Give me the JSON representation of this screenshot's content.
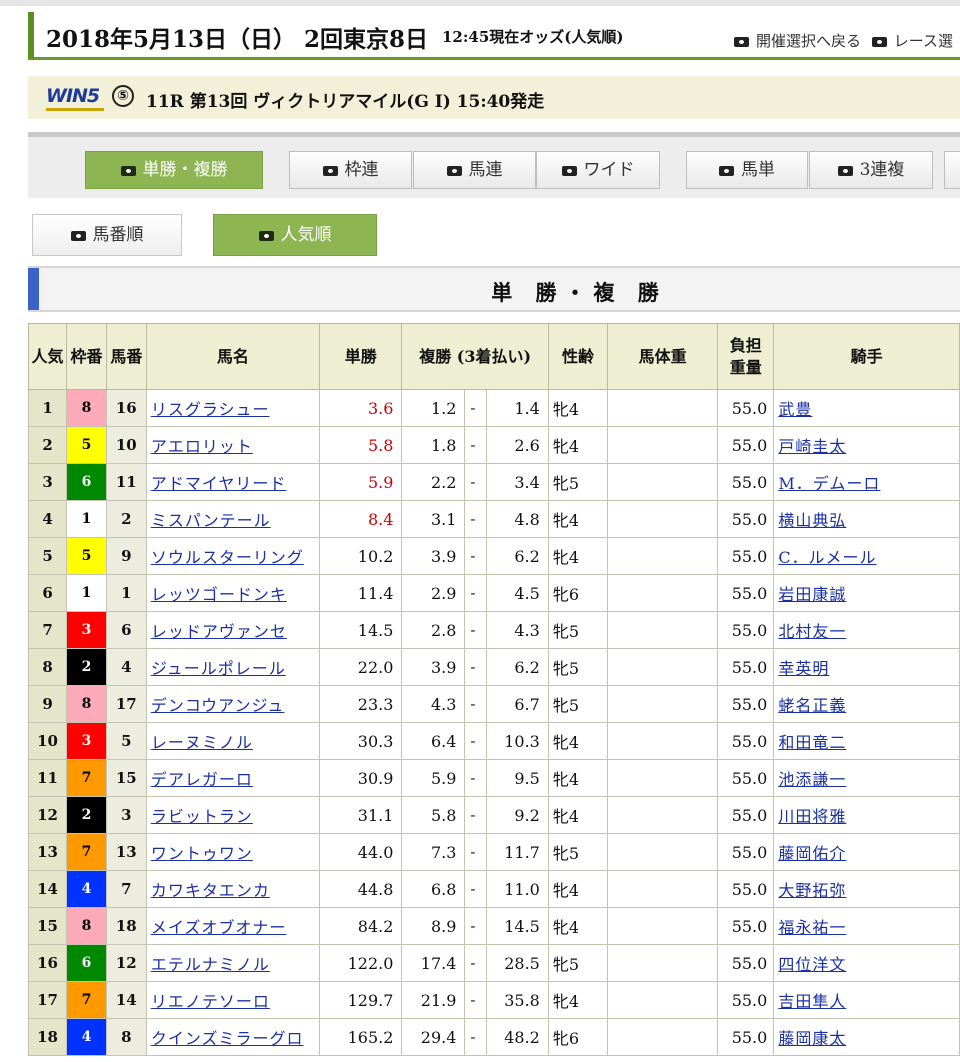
{
  "header": {
    "date_race": "2018年5月13日（日） 2回東京8日",
    "odds_time": "12:45現在オッズ(人気順)",
    "nav_back": "開催選択へ戻る",
    "nav_race": "レース選"
  },
  "race": {
    "logo": "WIN5",
    "win5_number": "⑤",
    "title": "11R 第13回 ヴィクトリアマイル(G Ⅰ) 15:40発走"
  },
  "bet_tabs": [
    "単勝・複勝",
    "枠連",
    "馬連",
    "ワイド",
    "馬単",
    "3連複"
  ],
  "sort_tabs": [
    "馬番順",
    "人気順"
  ],
  "section_title": "単 勝・複 勝",
  "table": {
    "headers": {
      "popularity": "人気",
      "frame": "枠番",
      "horse_no": "馬番",
      "name": "馬名",
      "win": "単勝",
      "place": "複勝 (3着払い)",
      "sex_age": "性齢",
      "body_weight": "馬体重",
      "burden_1": "負担",
      "burden_2": "重量",
      "jockey": "騎手"
    },
    "rows": [
      {
        "pop": "1",
        "waku": "8",
        "uma": "16",
        "name": "リスグラシュー",
        "win": "3.6",
        "place_min": "1.2",
        "place_max": "1.4",
        "sex": "牝4",
        "body": "",
        "weight": "55.0",
        "jockey": "武豊"
      },
      {
        "pop": "2",
        "waku": "5",
        "uma": "10",
        "name": "アエロリット",
        "win": "5.8",
        "place_min": "1.8",
        "place_max": "2.6",
        "sex": "牝4",
        "body": "",
        "weight": "55.0",
        "jockey": "戸崎圭太"
      },
      {
        "pop": "3",
        "waku": "6",
        "uma": "11",
        "name": "アドマイヤリード",
        "win": "5.9",
        "place_min": "2.2",
        "place_max": "3.4",
        "sex": "牝5",
        "body": "",
        "weight": "55.0",
        "jockey": "M．デムーロ"
      },
      {
        "pop": "4",
        "waku": "1",
        "uma": "2",
        "name": "ミスパンテール",
        "win": "8.4",
        "place_min": "3.1",
        "place_max": "4.8",
        "sex": "牝4",
        "body": "",
        "weight": "55.0",
        "jockey": "横山典弘"
      },
      {
        "pop": "5",
        "waku": "5",
        "uma": "9",
        "name": "ソウルスターリング",
        "win": "10.2",
        "place_min": "3.9",
        "place_max": "6.2",
        "sex": "牝4",
        "body": "",
        "weight": "55.0",
        "jockey": "C．ルメール"
      },
      {
        "pop": "6",
        "waku": "1",
        "uma": "1",
        "name": "レッツゴードンキ",
        "win": "11.4",
        "place_min": "2.9",
        "place_max": "4.5",
        "sex": "牝6",
        "body": "",
        "weight": "55.0",
        "jockey": "岩田康誠"
      },
      {
        "pop": "7",
        "waku": "3",
        "uma": "6",
        "name": "レッドアヴァンセ",
        "win": "14.5",
        "place_min": "2.8",
        "place_max": "4.3",
        "sex": "牝5",
        "body": "",
        "weight": "55.0",
        "jockey": "北村友一"
      },
      {
        "pop": "8",
        "waku": "2",
        "uma": "4",
        "name": "ジュールポレール",
        "win": "22.0",
        "place_min": "3.9",
        "place_max": "6.2",
        "sex": "牝5",
        "body": "",
        "weight": "55.0",
        "jockey": "幸英明"
      },
      {
        "pop": "9",
        "waku": "8",
        "uma": "17",
        "name": "デンコウアンジュ",
        "win": "23.3",
        "place_min": "4.3",
        "place_max": "6.7",
        "sex": "牝5",
        "body": "",
        "weight": "55.0",
        "jockey": "蛯名正義"
      },
      {
        "pop": "10",
        "waku": "3",
        "uma": "5",
        "name": "レーヌミノル",
        "win": "30.3",
        "place_min": "6.4",
        "place_max": "10.3",
        "sex": "牝4",
        "body": "",
        "weight": "55.0",
        "jockey": "和田竜二"
      },
      {
        "pop": "11",
        "waku": "7",
        "uma": "15",
        "name": "デアレガーロ",
        "win": "30.9",
        "place_min": "5.9",
        "place_max": "9.5",
        "sex": "牝4",
        "body": "",
        "weight": "55.0",
        "jockey": "池添謙一"
      },
      {
        "pop": "12",
        "waku": "2",
        "uma": "3",
        "name": "ラビットラン",
        "win": "31.1",
        "place_min": "5.8",
        "place_max": "9.2",
        "sex": "牝4",
        "body": "",
        "weight": "55.0",
        "jockey": "川田将雅"
      },
      {
        "pop": "13",
        "waku": "7",
        "uma": "13",
        "name": "ワントゥワン",
        "win": "44.0",
        "place_min": "7.3",
        "place_max": "11.7",
        "sex": "牝5",
        "body": "",
        "weight": "55.0",
        "jockey": "藤岡佑介"
      },
      {
        "pop": "14",
        "waku": "4",
        "uma": "7",
        "name": "カワキタエンカ",
        "win": "44.8",
        "place_min": "6.8",
        "place_max": "11.0",
        "sex": "牝4",
        "body": "",
        "weight": "55.0",
        "jockey": "大野拓弥"
      },
      {
        "pop": "15",
        "waku": "8",
        "uma": "18",
        "name": "メイズオブオナー",
        "win": "84.2",
        "place_min": "8.9",
        "place_max": "14.5",
        "sex": "牝4",
        "body": "",
        "weight": "55.0",
        "jockey": "福永祐一"
      },
      {
        "pop": "16",
        "waku": "6",
        "uma": "12",
        "name": "エテルナミノル",
        "win": "122.0",
        "place_min": "17.4",
        "place_max": "28.5",
        "sex": "牝5",
        "body": "",
        "weight": "55.0",
        "jockey": "四位洋文"
      },
      {
        "pop": "17",
        "waku": "7",
        "uma": "14",
        "name": "リエノテソーロ",
        "win": "129.7",
        "place_min": "21.9",
        "place_max": "35.8",
        "sex": "牝4",
        "body": "",
        "weight": "55.0",
        "jockey": "吉田隼人"
      },
      {
        "pop": "18",
        "waku": "4",
        "uma": "8",
        "name": "クインズミラーグロ",
        "win": "165.2",
        "place_min": "29.4",
        "place_max": "48.2",
        "sex": "牝6",
        "body": "",
        "weight": "55.0",
        "jockey": "藤岡康太"
      }
    ]
  },
  "colors": {
    "accent_green": "#8db552",
    "header_green": "#5b8f1f",
    "link_blue": "#1a2fa8",
    "favorite_red": "#d00000",
    "section_blue": "#3a62c9",
    "waku_bg": {
      "1": "#ffffff",
      "2": "#000000",
      "3": "#ff0000",
      "4": "#0033ff",
      "5": "#ffff00",
      "6": "#008800",
      "7": "#ff9900",
      "8": "#ffaabb"
    },
    "waku_fg": {
      "1": "#000000",
      "2": "#ffffff",
      "3": "#ffffff",
      "4": "#ffffff",
      "5": "#000000",
      "6": "#ffffff",
      "7": "#000000",
      "8": "#000000"
    }
  },
  "icons": {
    "tab_marker": "pill-icon"
  }
}
